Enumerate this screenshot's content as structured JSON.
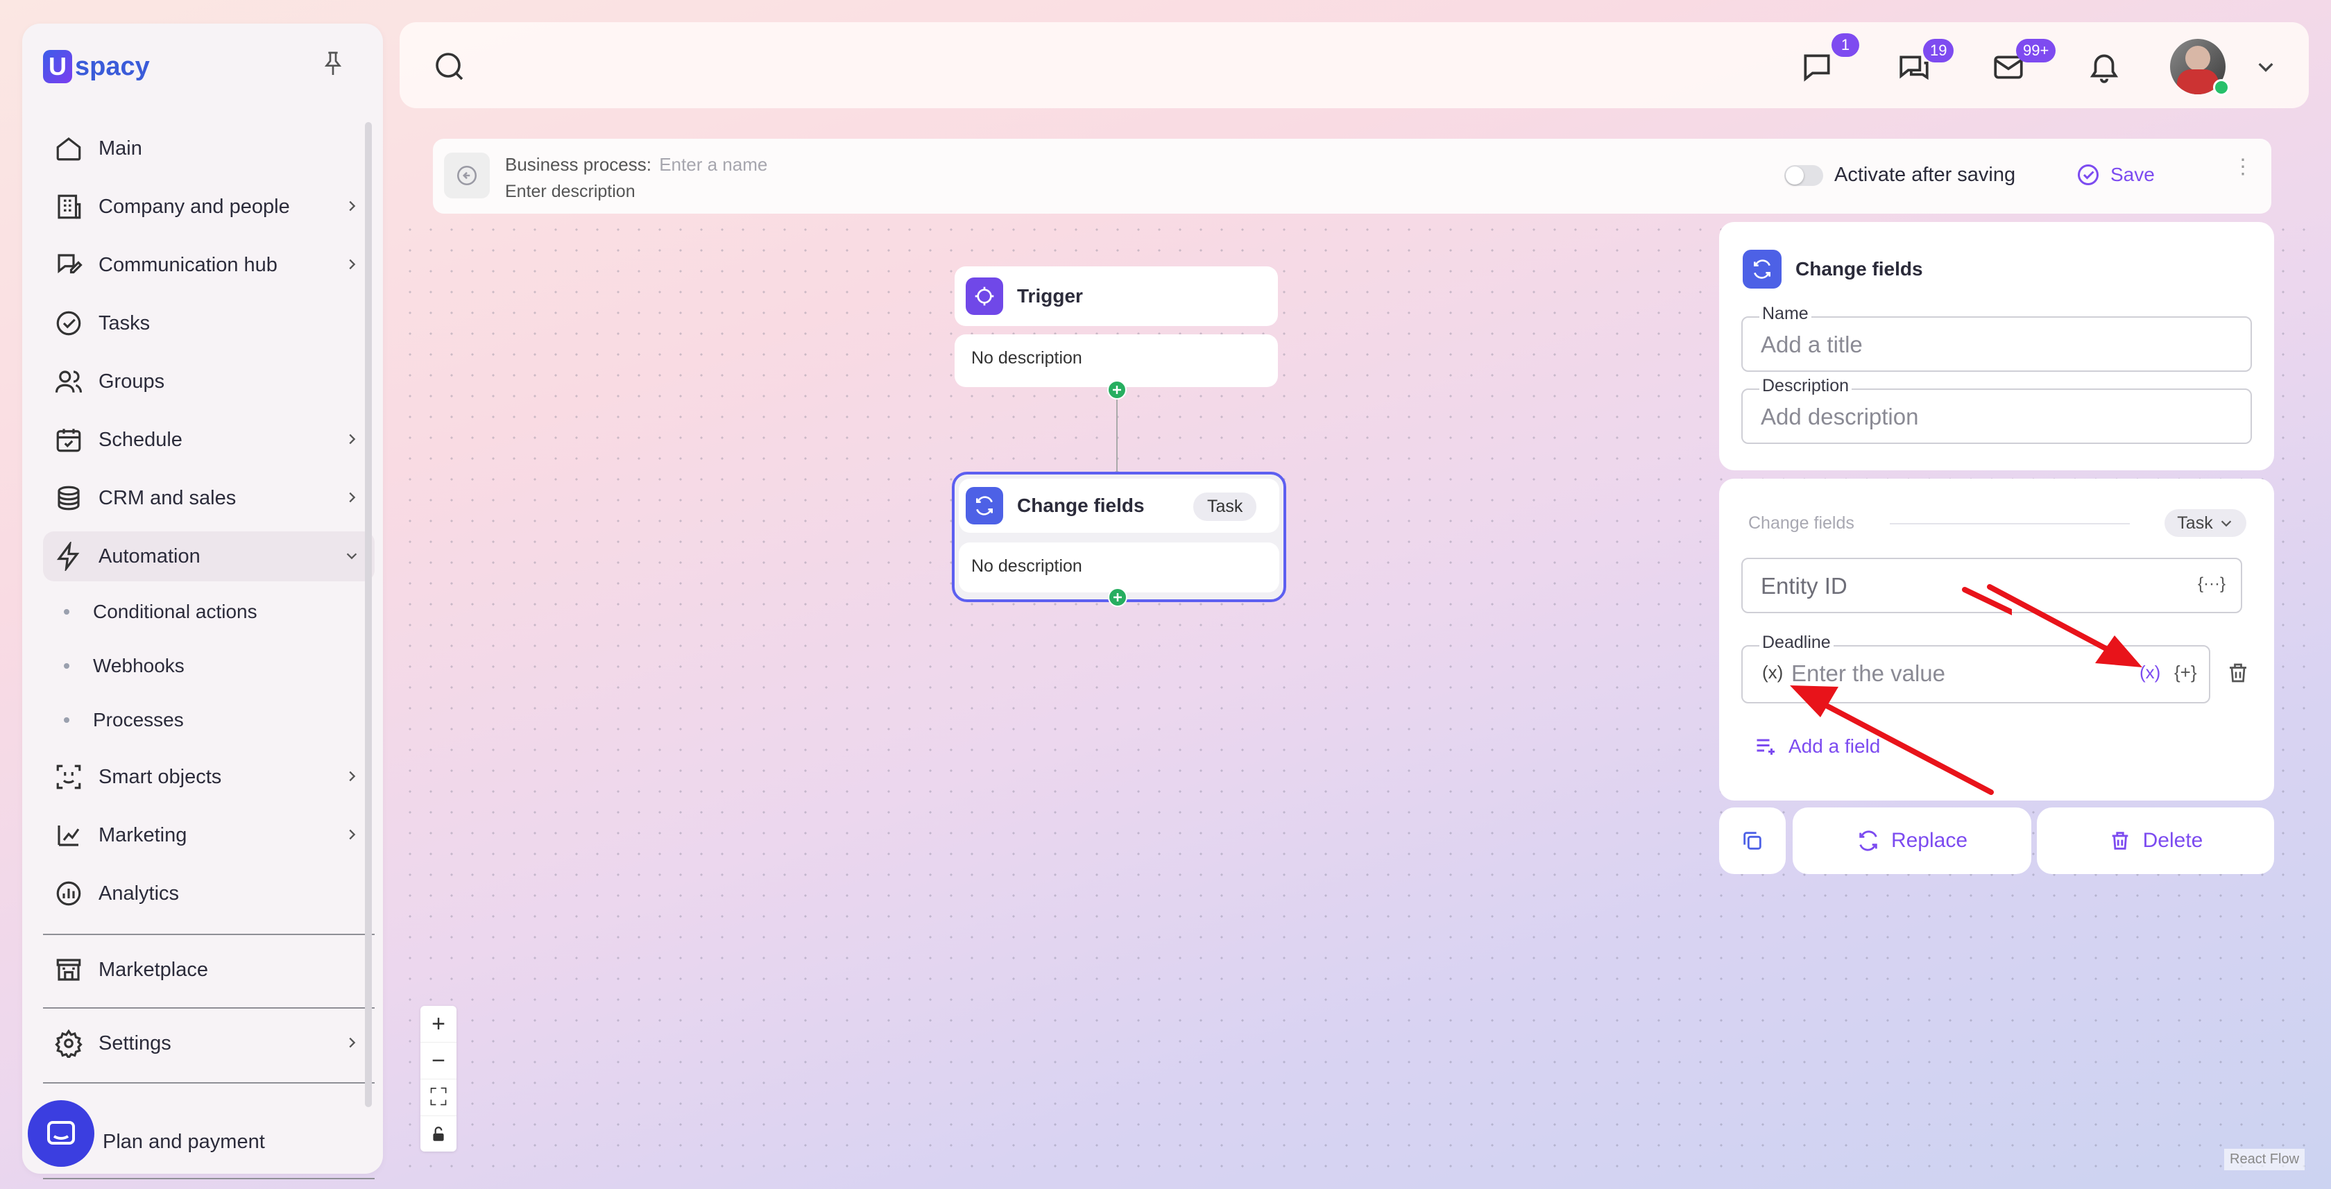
{
  "app": {
    "logo_text": "spacy",
    "logo_letter": "U"
  },
  "sidebar": {
    "items": [
      {
        "label": "Main"
      },
      {
        "label": "Company and people"
      },
      {
        "label": "Communication hub"
      },
      {
        "label": "Tasks"
      },
      {
        "label": "Groups"
      },
      {
        "label": "Schedule"
      },
      {
        "label": "CRM and sales"
      },
      {
        "label": "Automation"
      },
      {
        "label": "Smart objects"
      },
      {
        "label": "Marketing"
      },
      {
        "label": "Analytics"
      },
      {
        "label": "Marketplace"
      },
      {
        "label": "Settings"
      },
      {
        "label": "Plan and payment"
      }
    ],
    "automation_sub": [
      {
        "label": "Conditional actions"
      },
      {
        "label": "Webhooks"
      },
      {
        "label": "Processes"
      }
    ]
  },
  "header": {
    "badges": {
      "comments": "1",
      "chats": "19",
      "mail": "99+"
    }
  },
  "process": {
    "label": "Business process:",
    "name_placeholder": "Enter a name",
    "description_placeholder": "Enter description",
    "activate_label": "Activate after saving",
    "save_label": "Save"
  },
  "canvas": {
    "trigger": {
      "title": "Trigger",
      "description": "No description"
    },
    "change": {
      "title": "Change fields",
      "tag": "Task",
      "description": "No description"
    },
    "watermark": "React Flow"
  },
  "panel": {
    "title": "Change fields",
    "name_label": "Name",
    "name_placeholder": "Add a title",
    "desc_label": "Description",
    "desc_placeholder": "Add description",
    "section_label": "Change fields",
    "entity_select": "Task",
    "entity_id_placeholder": "Entity ID",
    "entity_icon": "{···}",
    "deadline_label": "Deadline",
    "deadline_placeholder": "Enter the value",
    "var_icon": "(x)",
    "plus_icon": "{+}",
    "add_field": "Add a field",
    "replace": "Replace",
    "delete": "Delete"
  },
  "colors": {
    "accent": "#7c4bf0",
    "annotation": "#e8131a"
  }
}
